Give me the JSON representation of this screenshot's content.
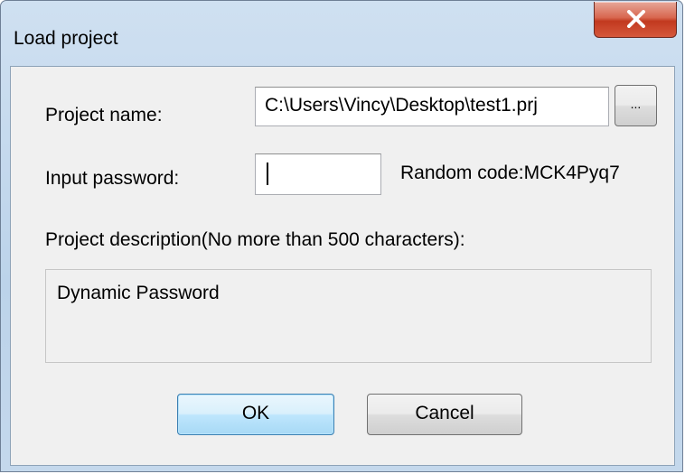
{
  "window": {
    "title": "Load project",
    "close_icon": "close-icon"
  },
  "form": {
    "project_name_label": "Project name:",
    "project_name_value": "C:\\Users\\Vincy\\Desktop\\test1.prj",
    "browse_label": "...",
    "password_label": "Input password:",
    "password_value": "",
    "random_code_text": "Random code:MCK4Pyq7",
    "description_label": "Project description(No more than 500 characters):",
    "description_value": "Dynamic Password"
  },
  "buttons": {
    "ok_label": "OK",
    "cancel_label": "Cancel"
  },
  "colors": {
    "title_bar": "#bcd3ea",
    "close_button": "#c2391f",
    "default_button_border": "#3c7fb1"
  }
}
